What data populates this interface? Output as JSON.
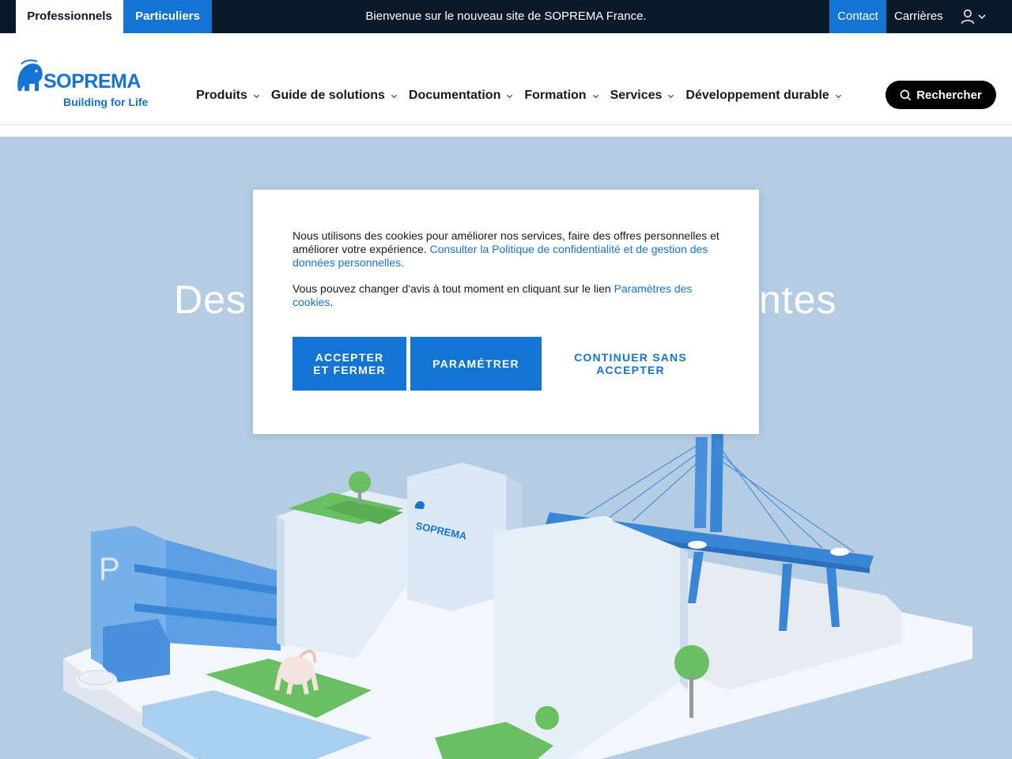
{
  "topbar": {
    "audience_tabs": [
      "Professionnels",
      "Particuliers"
    ],
    "welcome": "Bienvenue sur le nouveau site de SOPREMA France.",
    "contact": "Contact",
    "careers": "Carrières",
    "account_icon": "user-icon"
  },
  "header": {
    "logo_text": "SOPREMA",
    "logo_tagline": "Building for Life",
    "nav": [
      "Produits",
      "Guide de solutions",
      "Documentation",
      "Formation",
      "Services",
      "Développement durable"
    ],
    "search_label": "Rechercher"
  },
  "hero": {
    "title_left": "Des",
    "title_right": "ntes",
    "illustration_logo": "SOPREMA",
    "parking_sign": "P"
  },
  "cookie": {
    "text1": "Nous utilisons des cookies pour améliorer nos services, faire des offres personnelles et améliorer votre expérience. ",
    "link1": "Consulter la Politique de confidentialité et de gestion des données personnelles.",
    "text2": "Vous pouvez changer d'avis à tout moment en cliquant sur le lien ",
    "link2": "Paramètres des cookies",
    "text2_end": ".",
    "accept": "Accepter et fermer",
    "settings": "Paramétrer",
    "continue": "Continuer sans accepter"
  },
  "colors": {
    "topbar_bg": "#0a1a2b",
    "brand_blue": "#1474d4",
    "hero_bg": "#b4cde3",
    "search_bg": "#000000"
  }
}
